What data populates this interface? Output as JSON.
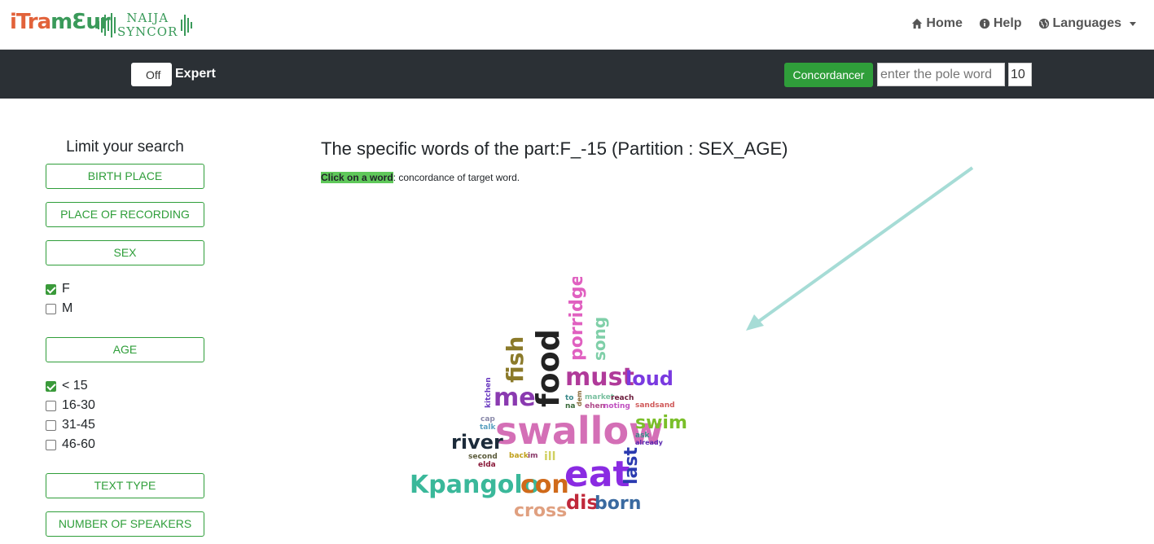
{
  "nav": {
    "logo_brand_a": "iTra",
    "logo_brand_b": "mƐur",
    "logo_naija_line1": "NAIJA",
    "logo_naija_line2": "SYNCOR",
    "home": "Home",
    "help": "Help",
    "languages": "Languages"
  },
  "toolbar": {
    "toggle_state": "Off",
    "expert_label": "Expert",
    "concordancer_label": "Concordancer",
    "pole_placeholder": "enter the pole word",
    "count_value": "10"
  },
  "sidebar": {
    "title": "Limit your search",
    "filters": {
      "birth_place": "BIRTH PLACE",
      "place_of_recording": "PLACE OF RECORDING",
      "sex": "SEX",
      "age": "AGE",
      "text_type": "TEXT TYPE",
      "number_of_speakers": "NUMBER OF SPEAKERS"
    },
    "sex_options": [
      {
        "label": "F",
        "checked": true
      },
      {
        "label": "M",
        "checked": false
      }
    ],
    "age_options": [
      {
        "label": "< 15",
        "checked": true
      },
      {
        "label": "16-30",
        "checked": false
      },
      {
        "label": "31-45",
        "checked": false
      },
      {
        "label": "46-60",
        "checked": false
      }
    ]
  },
  "main": {
    "title": "The specific words of the part:F_-15 (Partition : SEX_AGE)",
    "hint_highlight": "Click on a word",
    "hint_rest": ": concordance of target word."
  },
  "wordcloud": {
    "words": [
      {
        "text": "swallow",
        "color": "#d46fb6"
      },
      {
        "text": "eat",
        "color": "#8a2be2"
      },
      {
        "text": "food",
        "color": "#222222"
      },
      {
        "text": "fish",
        "color": "#8b7a2a"
      },
      {
        "text": "porridge",
        "color": "#e060c0"
      },
      {
        "text": "song",
        "color": "#7fcfa8"
      },
      {
        "text": "must",
        "color": "#b03a9a"
      },
      {
        "text": "loud",
        "color": "#7a3ae0"
      },
      {
        "text": "me",
        "color": "#8a3ab0"
      },
      {
        "text": "swim",
        "color": "#7abf2a"
      },
      {
        "text": "river",
        "color": "#1c2b3a"
      },
      {
        "text": "Kpangolo",
        "color": "#3ab89a"
      },
      {
        "text": "con",
        "color": "#d06a1a"
      },
      {
        "text": "dis",
        "color": "#c0283a"
      },
      {
        "text": "born",
        "color": "#3a6aa0"
      },
      {
        "text": "cross",
        "color": "#e0a080"
      },
      {
        "text": "last",
        "color": "#2a3ab0"
      },
      {
        "text": "kitchen",
        "color": "#6a3ac0"
      },
      {
        "text": "cap",
        "color": "#8a8aaa"
      },
      {
        "text": "talk",
        "color": "#5aa0c0"
      },
      {
        "text": "to",
        "color": "#3a8a8a"
      },
      {
        "text": "na",
        "color": "#3a6a3a"
      },
      {
        "text": "dem",
        "color": "#8a6a3a"
      },
      {
        "text": "market",
        "color": "#7ac0a0"
      },
      {
        "text": "reach",
        "color": "#6a1a3a"
      },
      {
        "text": "ehen",
        "color": "#b04a8a"
      },
      {
        "text": "noting",
        "color": "#c050c0"
      },
      {
        "text": "sandsand",
        "color": "#d05a5a"
      },
      {
        "text": "ask",
        "color": "#3a8a8a"
      },
      {
        "text": "already",
        "color": "#5a2ab0"
      },
      {
        "text": "second",
        "color": "#5a5a3a"
      },
      {
        "text": "elda",
        "color": "#8a1a3a"
      },
      {
        "text": "back",
        "color": "#c0a01a"
      },
      {
        "text": "im",
        "color": "#8a3a6a"
      },
      {
        "text": "ill",
        "color": "#d0d060"
      }
    ]
  }
}
